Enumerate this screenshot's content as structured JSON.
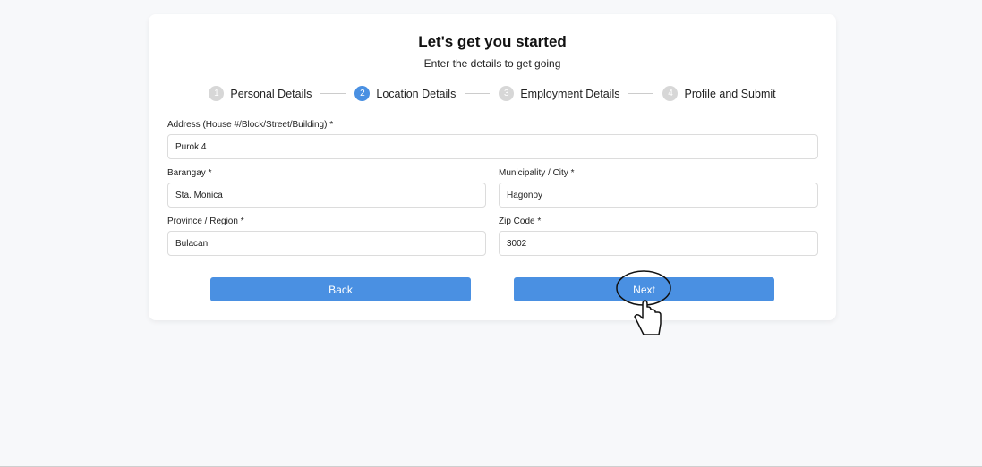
{
  "header": {
    "title": "Let's get you started",
    "subtitle": "Enter the details to get going"
  },
  "stepper": {
    "steps": [
      {
        "number": "1",
        "label": "Personal Details",
        "active": false
      },
      {
        "number": "2",
        "label": "Location Details",
        "active": true
      },
      {
        "number": "3",
        "label": "Employment Details",
        "active": false
      },
      {
        "number": "4",
        "label": "Profile and Submit",
        "active": false
      }
    ]
  },
  "form": {
    "address": {
      "label": "Address (House #/Block/Street/Building) *",
      "value": "Purok 4"
    },
    "barangay": {
      "label": "Barangay *",
      "value": "Sta. Monica"
    },
    "municipality": {
      "label": "Municipality / City *",
      "value": "Hagonoy"
    },
    "province": {
      "label": "Province / Region *",
      "value": "Bulacan"
    },
    "zip": {
      "label": "Zip Code *",
      "value": "3002"
    }
  },
  "buttons": {
    "back": "Back",
    "next": "Next"
  },
  "colors": {
    "accent": "#4a90e2",
    "inactive_step": "#d7d7d7",
    "background": "#f7f8fa"
  }
}
